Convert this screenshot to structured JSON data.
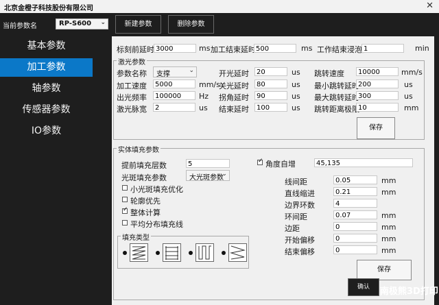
{
  "window": {
    "title": "北京金橙子科技股份有限公司",
    "close": "✕"
  },
  "topbar": {
    "param_name_label": "当前参数名",
    "param_select": "RP-S600",
    "new_button": "新建参数",
    "delete_button": "删除参数"
  },
  "sidebar": {
    "items": [
      {
        "label": "基本参数"
      },
      {
        "label": "加工参数"
      },
      {
        "label": "轴参数"
      },
      {
        "label": "传感器参数"
      },
      {
        "label": "IO参数"
      }
    ]
  },
  "delays": {
    "mark_before": {
      "label": "标刻前延时",
      "value": "3000",
      "unit": "ms"
    },
    "process_end": {
      "label": "加工结束延时",
      "value": "500",
      "unit": "ms"
    },
    "soak": {
      "label": "工作结束浸泡延时",
      "value": "1",
      "unit": "min"
    }
  },
  "laser": {
    "title": "激光参数",
    "param_name": {
      "label": "参数名称",
      "value": "支撑"
    },
    "speed": {
      "label": "加工速度",
      "value": "5000",
      "unit": "mm/s"
    },
    "freq": {
      "label": "出光频率",
      "value": "100000",
      "unit": "Hz"
    },
    "pulse": {
      "label": "激光脉宽",
      "value": "2",
      "unit": "us"
    },
    "on_delay": {
      "label": "开光延时",
      "value": "20",
      "unit": "us"
    },
    "off_delay": {
      "label": "关光延时",
      "value": "80",
      "unit": "us"
    },
    "corner_delay": {
      "label": "拐角延时",
      "value": "90",
      "unit": "us"
    },
    "end_delay": {
      "label": "结束延时",
      "value": "100",
      "unit": "us"
    },
    "jump_speed": {
      "label": "跳转速度",
      "value": "10000",
      "unit": "mm/s"
    },
    "min_jump": {
      "label": "最小跳转延时",
      "value": "200",
      "unit": "us"
    },
    "max_jump": {
      "label": "最大跳转延时",
      "value": "300",
      "unit": "us"
    },
    "jump_limit": {
      "label": "跳转距离极限",
      "value": "10",
      "unit": "mm"
    },
    "save": "保存"
  },
  "fill": {
    "title": "实体填充参数",
    "layers": {
      "label": "提前填充层数",
      "value": "5"
    },
    "spot_param": {
      "label": "光斑填充参数",
      "value": "大光斑参数"
    },
    "checks": [
      {
        "label": "小光斑填充优化",
        "checked": false
      },
      {
        "label": "轮廓优先",
        "checked": false
      },
      {
        "label": "整体计算",
        "checked": true
      },
      {
        "label": "平均分布填充线",
        "checked": false
      }
    ],
    "angle_auto": {
      "label": "角度自增",
      "checked": true,
      "value": "45,135"
    },
    "line_spacing": {
      "label": "线间距",
      "value": "0.05",
      "unit": "mm"
    },
    "shrink": {
      "label": "直线缩进",
      "value": "0.21",
      "unit": "mm"
    },
    "border_rings": {
      "label": "边界环数",
      "value": "4"
    },
    "ring_spacing": {
      "label": "环间距",
      "value": "0.07",
      "unit": "mm"
    },
    "margin": {
      "label": "边距",
      "value": "0",
      "unit": "mm"
    },
    "start_offset": {
      "label": "开始偏移",
      "value": "0",
      "unit": "mm"
    },
    "end_offset": {
      "label": "结束偏移",
      "value": "0",
      "unit": "mm"
    },
    "type_title": "填充类型",
    "save": "保存"
  },
  "confirm_button": "确认",
  "watermark": "南极熊3D打印"
}
